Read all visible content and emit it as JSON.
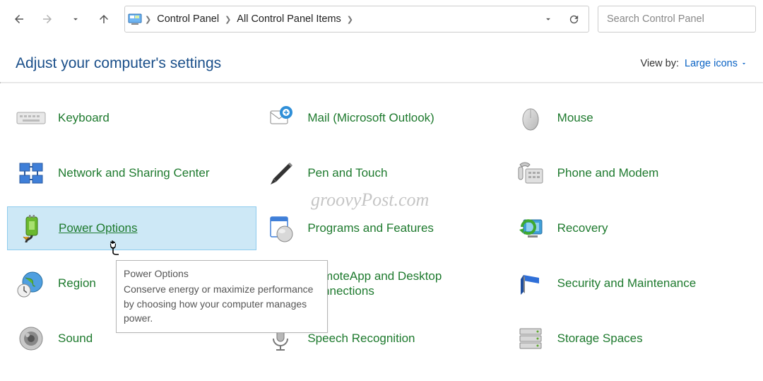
{
  "breadcrumb": {
    "root": "Control Panel",
    "current": "All Control Panel Items"
  },
  "search": {
    "placeholder": "Search Control Panel"
  },
  "header": {
    "title": "Adjust your computer's settings",
    "view_by_label": "View by:",
    "view_by_value": "Large icons"
  },
  "items": {
    "keyboard": "Keyboard",
    "mail": "Mail (Microsoft Outlook)",
    "mouse": "Mouse",
    "network": "Network and Sharing Center",
    "pen": "Pen and Touch",
    "phone": "Phone and Modem",
    "power": "Power Options",
    "programs": "Programs and Features",
    "recovery": "Recovery",
    "region": "Region",
    "remoteapp": "RemoteApp and Desktop Connections",
    "security": "Security and Maintenance",
    "sound": "Sound",
    "speech": "Speech Recognition",
    "storage": "Storage Spaces"
  },
  "tooltip": {
    "title": "Power Options",
    "body": "Conserve energy or maximize performance by choosing how your computer manages power."
  },
  "watermark": "groovyPost.com"
}
